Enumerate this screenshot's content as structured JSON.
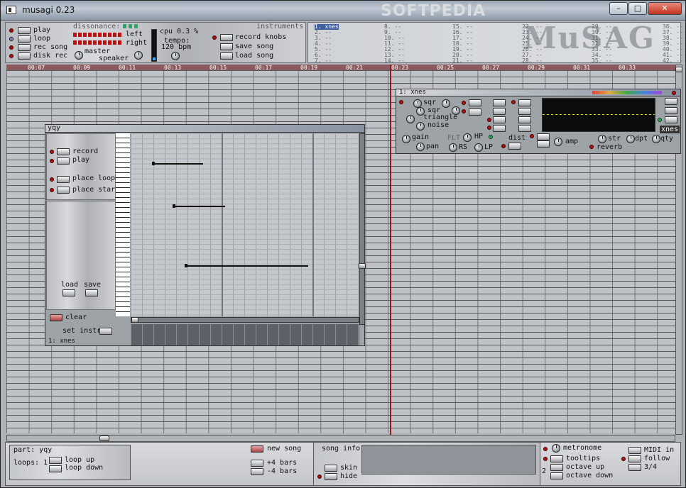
{
  "window": {
    "title": "musagi 0.23",
    "controls": {
      "min": "–",
      "max": "□",
      "close": "✕"
    }
  },
  "transport": {
    "play": "play",
    "loop": "loop",
    "rec_song": "rec song",
    "disk_rec": "disk rec",
    "dissonance": "dissonance:",
    "left": "left",
    "right": "right",
    "master": "master",
    "speaker": "speaker"
  },
  "status": {
    "cpu": "cpu 0.3 %",
    "tempo_label": "tempo:",
    "tempo": "120 bpm"
  },
  "song": {
    "record_knobs": "record knobs",
    "save_song": "save song",
    "load_song": "load song"
  },
  "instruments_label": "instruments",
  "instruments": [
    [
      "1. xnes",
      "2. --",
      "3. --",
      "4. --",
      "5. --",
      "6. --",
      "7. --"
    ],
    [
      "8. --",
      "9. --",
      "10. --",
      "11. --",
      "12. --",
      "13. --",
      "14. --"
    ],
    [
      "15. --",
      "16. --",
      "17. --",
      "18. --",
      "19. --",
      "20. --",
      "21. --"
    ],
    [
      "22. --",
      "23. --",
      "24. --",
      "25. --",
      "26. --",
      "27. --",
      "28. --"
    ],
    [
      "29. --",
      "30. --",
      "31. --",
      "32. --",
      "33. --",
      "34. --",
      "35. --"
    ],
    [
      "36. --",
      "37. --",
      "38. --",
      "39. --",
      "40. --",
      "41. --",
      "42. --"
    ]
  ],
  "ruler": [
    "00:07",
    "00:09",
    "00:11",
    "00:13",
    "00:15",
    "00:17",
    "00:19",
    "00:21",
    "00:23",
    "00:25",
    "00:27",
    "00:29",
    "00:31",
    "00:33"
  ],
  "part": {
    "name": "yqy",
    "record": "record",
    "play": "play",
    "place_loop": "place loop",
    "place_start": "place start",
    "load": "load",
    "save": "save",
    "clear": "clear",
    "set_instr": "set instr.",
    "instrument": "1: xnes"
  },
  "xnes": {
    "title": "1: xnes",
    "sqr1": "sqr",
    "sqr2": "sqr",
    "triangle": "triangle",
    "noise": "noise",
    "gain": "gain",
    "pan": "pan",
    "flt": "FLT",
    "hp": "HP",
    "rs": "RS",
    "lp": "LP",
    "dist": "dist",
    "amp": "amp",
    "str": "str",
    "dpt": "dpt",
    "qty": "qty",
    "reverb": "reverb",
    "tag": "xnes"
  },
  "bottom": {
    "part_label": "part: yqy",
    "loops": "loops: 1",
    "loop_up": "loop up",
    "loop_down": "loop down",
    "new_song": "new song",
    "plus4": "+4 bars",
    "minus4": "-4 bars",
    "song_info": "song info:",
    "skin": "skin",
    "hide": "hide",
    "metronome": "metronome",
    "tooltips": "tooltips",
    "octave_up": "octave up",
    "octave_down": "octave down",
    "octave_value": "2",
    "midi_in": "MIDI in",
    "follow": "follow",
    "time_sig": "3/4"
  },
  "watermark": "SOFTPEDIA"
}
